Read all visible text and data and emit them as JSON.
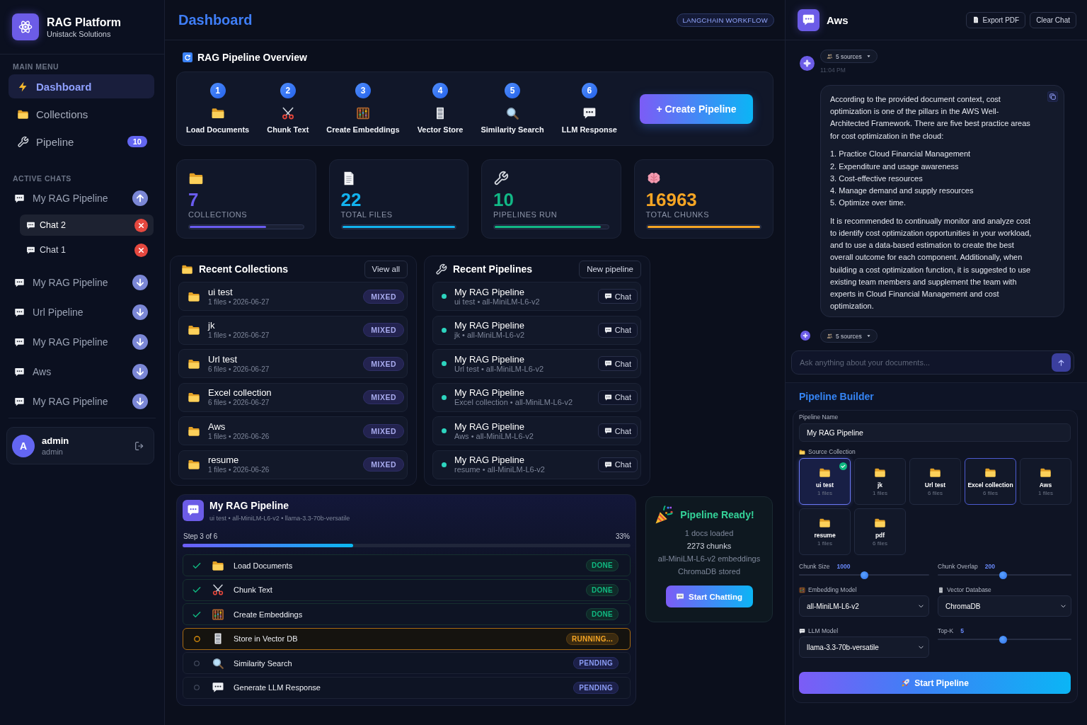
{
  "sidebar": {
    "brand": {
      "title": "RAG Platform",
      "subtitle": "Unistack Solutions"
    },
    "main_menu": {
      "heading": "MAIN MENU",
      "items": [
        {
          "label": "Dashboard",
          "selected": true
        },
        {
          "label": "Collections",
          "selected": false
        },
        {
          "label": "Pipeline",
          "selected": false,
          "badge": "10"
        }
      ]
    },
    "active_chats": {
      "heading": "ACTIVE CHATS",
      "groups": [
        {
          "label": "My RAG Pipeline",
          "expanded": true,
          "children": [
            {
              "label": "Chat 2",
              "selected": true
            },
            {
              "label": "Chat 1",
              "selected": false
            }
          ]
        },
        {
          "label": "My RAG Pipeline",
          "expanded": false
        },
        {
          "label": "Url Pipeline",
          "expanded": false
        },
        {
          "label": "My RAG Pipeline",
          "expanded": false
        },
        {
          "label": "Aws",
          "expanded": false
        },
        {
          "label": "My RAG Pipeline",
          "expanded": false
        }
      ]
    },
    "user": {
      "initial": "A",
      "name": "admin",
      "role": "admin"
    }
  },
  "header": {
    "title": "Dashboard",
    "badge": "LANGCHAIN WORKFLOW"
  },
  "overview": {
    "title": "RAG Pipeline Overview",
    "steps": [
      {
        "number": "1",
        "label": "Load Documents"
      },
      {
        "number": "2",
        "label": "Chunk Text"
      },
      {
        "number": "3",
        "label": "Create Embeddings"
      },
      {
        "number": "4",
        "label": "Vector Store"
      },
      {
        "number": "5",
        "label": "Similarity Search"
      },
      {
        "number": "6",
        "label": "LLM Response"
      }
    ],
    "button": "+ Create Pipeline"
  },
  "stats": [
    {
      "value": "7",
      "label": "COLLECTIONS",
      "color": "#6a5cf0",
      "level": 0.68
    },
    {
      "value": "22",
      "label": "TOTAL FILES",
      "color": "#12b3ee",
      "level": 1
    },
    {
      "value": "10",
      "label": "PIPELINES RUN",
      "color": "#12b886",
      "level": 0.94
    },
    {
      "value": "16963",
      "label": "TOTAL CHUNKS",
      "color": "#f5a524",
      "level": 1
    }
  ],
  "recent_collections": {
    "title": "Recent Collections",
    "action": "View all",
    "rows": [
      {
        "name": "ui test",
        "meta": "1 files • 2026-06-27",
        "tag": "MIXED"
      },
      {
        "name": "jk",
        "meta": "1 files • 2026-06-27",
        "tag": "MIXED"
      },
      {
        "name": "Url test",
        "meta": "6 files • 2026-06-27",
        "tag": "MIXED"
      },
      {
        "name": "Excel collection",
        "meta": "6 files • 2026-06-27",
        "tag": "MIXED"
      },
      {
        "name": "Aws",
        "meta": "1 files • 2026-06-26",
        "tag": "MIXED"
      },
      {
        "name": "resume",
        "meta": "1 files • 2026-06-26",
        "tag": "MIXED"
      }
    ]
  },
  "recent_pipelines": {
    "title": "Recent Pipelines",
    "action": "New pipeline",
    "rows": [
      {
        "name": "My RAG Pipeline",
        "meta": "ui test • all-MiniLM-L6-v2",
        "button": "Chat"
      },
      {
        "name": "My RAG Pipeline",
        "meta": "jk • all-MiniLM-L6-v2",
        "button": "Chat"
      },
      {
        "name": "My RAG Pipeline",
        "meta": "Url test • all-MiniLM-L6-v2",
        "button": "Chat"
      },
      {
        "name": "My RAG Pipeline",
        "meta": "Excel collection • all-MiniLM-L6-v2",
        "button": "Chat"
      },
      {
        "name": "My RAG Pipeline",
        "meta": "Aws • all-MiniLM-L6-v2",
        "button": "Chat"
      },
      {
        "name": "My RAG Pipeline",
        "meta": "resume • all-MiniLM-L6-v2",
        "button": "Chat"
      }
    ]
  },
  "run": {
    "title": "My RAG Pipeline",
    "subtitle": "ui test • all-MiniLM-L6-v2 • llama-3.3-70b-versatile",
    "step_label": "Step 3 of 6",
    "percent": "33%",
    "level": 0.38,
    "steps": [
      {
        "label": "Load Documents",
        "kind": "done",
        "badge": "DONE"
      },
      {
        "label": "Chunk Text",
        "kind": "done",
        "badge": "DONE"
      },
      {
        "label": "Create Embeddings",
        "kind": "done",
        "badge": "DONE"
      },
      {
        "label": "Store in Vector DB",
        "kind": "running",
        "badge": "RUNNING..."
      },
      {
        "label": "Similarity Search",
        "kind": "pending",
        "badge": "PENDING"
      },
      {
        "label": "Generate LLM Response",
        "kind": "pending",
        "badge": "PENDING"
      }
    ]
  },
  "ready": {
    "title": "Pipeline Ready!",
    "lines": [
      {
        "text": "1 docs loaded",
        "highlight": false
      },
      {
        "text": "2273 chunks",
        "highlight": true
      },
      {
        "text": "all-MiniLM-L6-v2 embeddings",
        "highlight": false
      },
      {
        "text": "ChromaDB stored",
        "highlight": false
      }
    ],
    "button": "Start Chatting"
  },
  "chat": {
    "title": "Aws",
    "actions": [
      {
        "kind": "export",
        "label": "Export PDF"
      },
      {
        "kind": "clear",
        "label": "Clear Chat"
      }
    ],
    "messages": [
      {
        "sources": "5 sources",
        "time": "11:04 PM",
        "blocks": [
          {
            "kind": "paragraph",
            "text": "According to the provided document context, cost optimization is one of the pillars in the AWS Well-Architected Framework. There are five best practice areas for cost optimization in the cloud:"
          },
          {
            "kind": "list",
            "items": [
              "1. Practice Cloud Financial Management",
              "2. Expenditure and usage awareness",
              "3. Cost-effective resources",
              "4. Manage demand and supply resources",
              "5. Optimize over time."
            ]
          },
          {
            "kind": "paragraph",
            "text": "It is recommended to continually monitor and analyze cost to identify cost optimization opportunities in your workload, and to use a data-based estimation to create the best overall outcome for each component. Additionally, when building a cost optimization function, it is suggested to use existing team members and supplement the team with experts in Cloud Financial Management and cost optimization."
          }
        ]
      },
      {
        "sources": "5 sources"
      }
    ],
    "input": {
      "placeholder": "Ask anything about your documents..."
    }
  },
  "builder": {
    "title": "Pipeline Builder",
    "name_label": "Pipeline Name",
    "name_value": "My RAG Pipeline",
    "source_label": "Source Collection",
    "collections": [
      {
        "name": "ui test",
        "meta": "1 files",
        "selected": true,
        "highlighted": false
      },
      {
        "name": "jk",
        "meta": "1 files",
        "selected": false,
        "highlighted": false
      },
      {
        "name": "Url test",
        "meta": "6 files",
        "selected": false,
        "highlighted": false
      },
      {
        "name": "Excel collection",
        "meta": "6 files",
        "selected": false,
        "highlighted": true
      },
      {
        "name": "Aws",
        "meta": "1 files",
        "selected": false,
        "highlighted": false
      },
      {
        "name": "resume",
        "meta": "1 files",
        "selected": false,
        "highlighted": false
      },
      {
        "name": "pdf",
        "meta": "6 files",
        "selected": false,
        "highlighted": false
      }
    ],
    "fields": [
      {
        "kind": "slider",
        "label": "Chunk Size",
        "value": "1000",
        "level": 0.5
      },
      {
        "kind": "slider",
        "label": "Chunk Overlap",
        "value": "200",
        "level": 0.49
      },
      {
        "kind": "select",
        "label": "Embedding Model",
        "value": "all-MiniLM-L6-v2"
      },
      {
        "kind": "select",
        "label": "Vector Database",
        "value": "ChromaDB"
      },
      {
        "kind": "select",
        "label": "LLM Model",
        "value": "llama-3.3-70b-versatile"
      },
      {
        "kind": "slider",
        "label": "Top-K",
        "value": "5",
        "level": 0.49
      }
    ],
    "button": "Start Pipeline"
  }
}
